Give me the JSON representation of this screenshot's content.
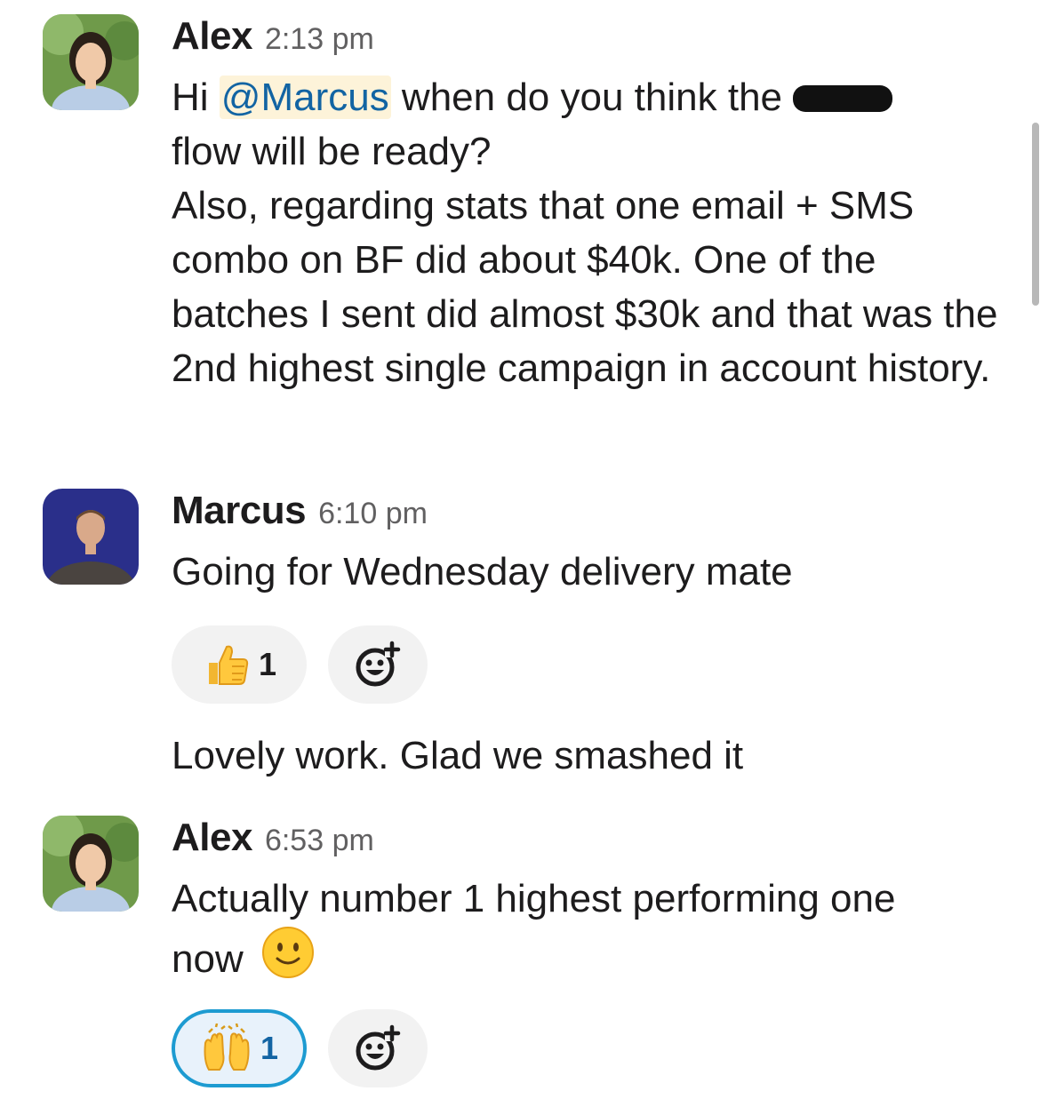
{
  "messages": [
    {
      "author": "Alex",
      "time": "2:13 pm",
      "text_prefix": "Hi ",
      "mention": "@Marcus",
      "text_after_mention": " when do you think the ",
      "text_line2": "flow will be ready?",
      "text_line3": "Also, regarding stats that one email + SMS combo on BF did about $40k. One of the batches I sent did almost $30k and that was the 2nd highest single campaign in account history."
    },
    {
      "author": "Marcus",
      "time": "6:10 pm",
      "text": "Going for Wednesday delivery mate",
      "reaction": {
        "emoji": "thumbs-up",
        "count": "1"
      },
      "followup": "Lovely work. Glad we smashed it"
    },
    {
      "author": "Alex",
      "time": "6:53 pm",
      "text": "Actually number 1 highest performing one now",
      "inline_emoji": "slightly-smiling-face",
      "reaction": {
        "emoji": "raised-hands",
        "count": "1",
        "active": true
      }
    }
  ],
  "colors": {
    "mention_bg": "#fdf3d9",
    "mention_text": "#1264a3",
    "active_reaction_border": "#1d9bd1"
  }
}
